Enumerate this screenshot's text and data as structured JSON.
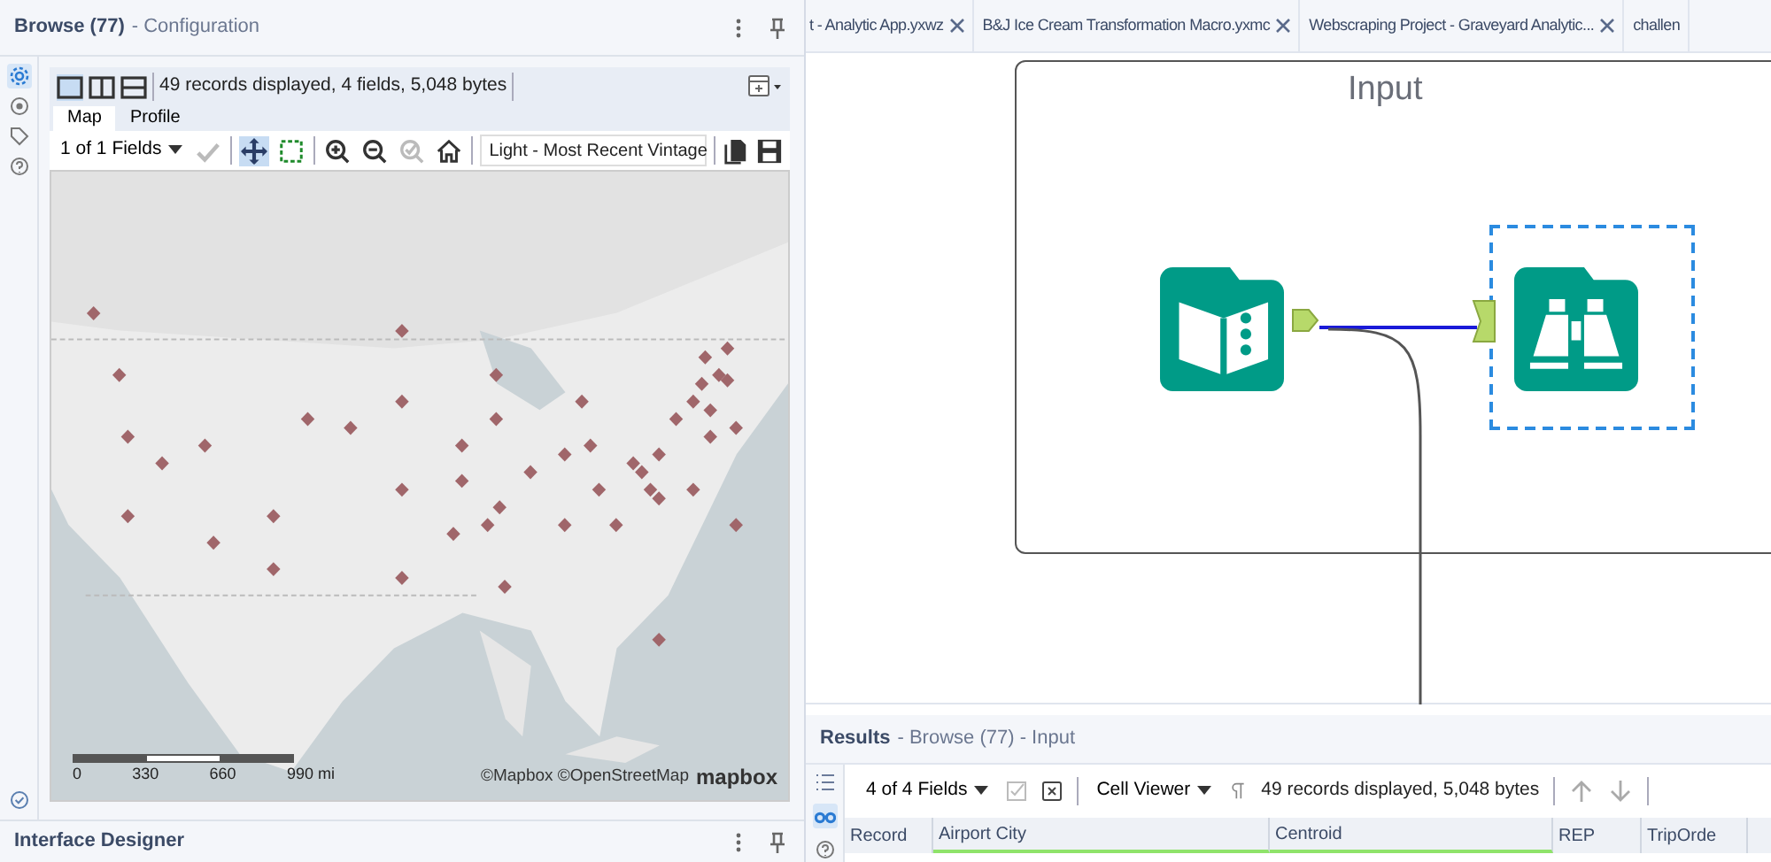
{
  "config_panel": {
    "title": "Browse (77)",
    "subtitle": "- Configuration",
    "side_icons": [
      {
        "kind": "gear",
        "selected": true
      },
      {
        "kind": "circle",
        "selected": false
      },
      {
        "kind": "tag",
        "selected": false
      },
      {
        "kind": "help",
        "selected": false
      }
    ],
    "view_buttons": [
      {
        "kind": "single",
        "selected": true
      },
      {
        "kind": "split-v",
        "selected": false
      },
      {
        "kind": "split-h",
        "selected": false
      }
    ],
    "info": "49 records displayed, 4 fields, 5,048 bytes",
    "tabs": [
      {
        "label": "Map",
        "selected": true
      },
      {
        "label": "Profile",
        "selected": false
      }
    ],
    "fields_select": "1 of 1 Fields",
    "tools": [
      {
        "kind": "check",
        "disabled": true
      },
      {
        "kind": "pan",
        "selected": true
      },
      {
        "kind": "select",
        "selected": false
      },
      {
        "kind": "zoom-in"
      },
      {
        "kind": "zoom-out"
      },
      {
        "kind": "zoom-check",
        "disabled": true
      },
      {
        "kind": "home"
      }
    ],
    "basemap": "Light - Most Recent Vintage",
    "map": {
      "kind": "picture",
      "scale_labels": [
        "0",
        "330",
        "660",
        "990 mi"
      ],
      "attribution": "©Mapbox ©OpenStreetMap",
      "logo": "mapbox"
    }
  },
  "designer_panel": {
    "title": "Interface Designer"
  },
  "doc_tabs": [
    {
      "label": "t - Analytic App.yxwz"
    },
    {
      "label": "B&J Ice Cream Transformation Macro.yxmc"
    },
    {
      "label": "Webscraping Project - Graveyard Analytic..."
    },
    {
      "label": "challen"
    }
  ],
  "canvas": {
    "container_title": "Input",
    "tools": [
      {
        "kind": "input",
        "selected": false
      },
      {
        "kind": "browse",
        "selected": true
      }
    ]
  },
  "results": {
    "title": "Results",
    "subtitle": "- Browse (77) - Input",
    "fields_select": "4 of 4 Fields",
    "viewer": "Cell Viewer",
    "info": "49 records displayed, 5,048 bytes",
    "columns": [
      "Record",
      "Airport City",
      "Centroid",
      "REP",
      "TripOrde"
    ]
  }
}
